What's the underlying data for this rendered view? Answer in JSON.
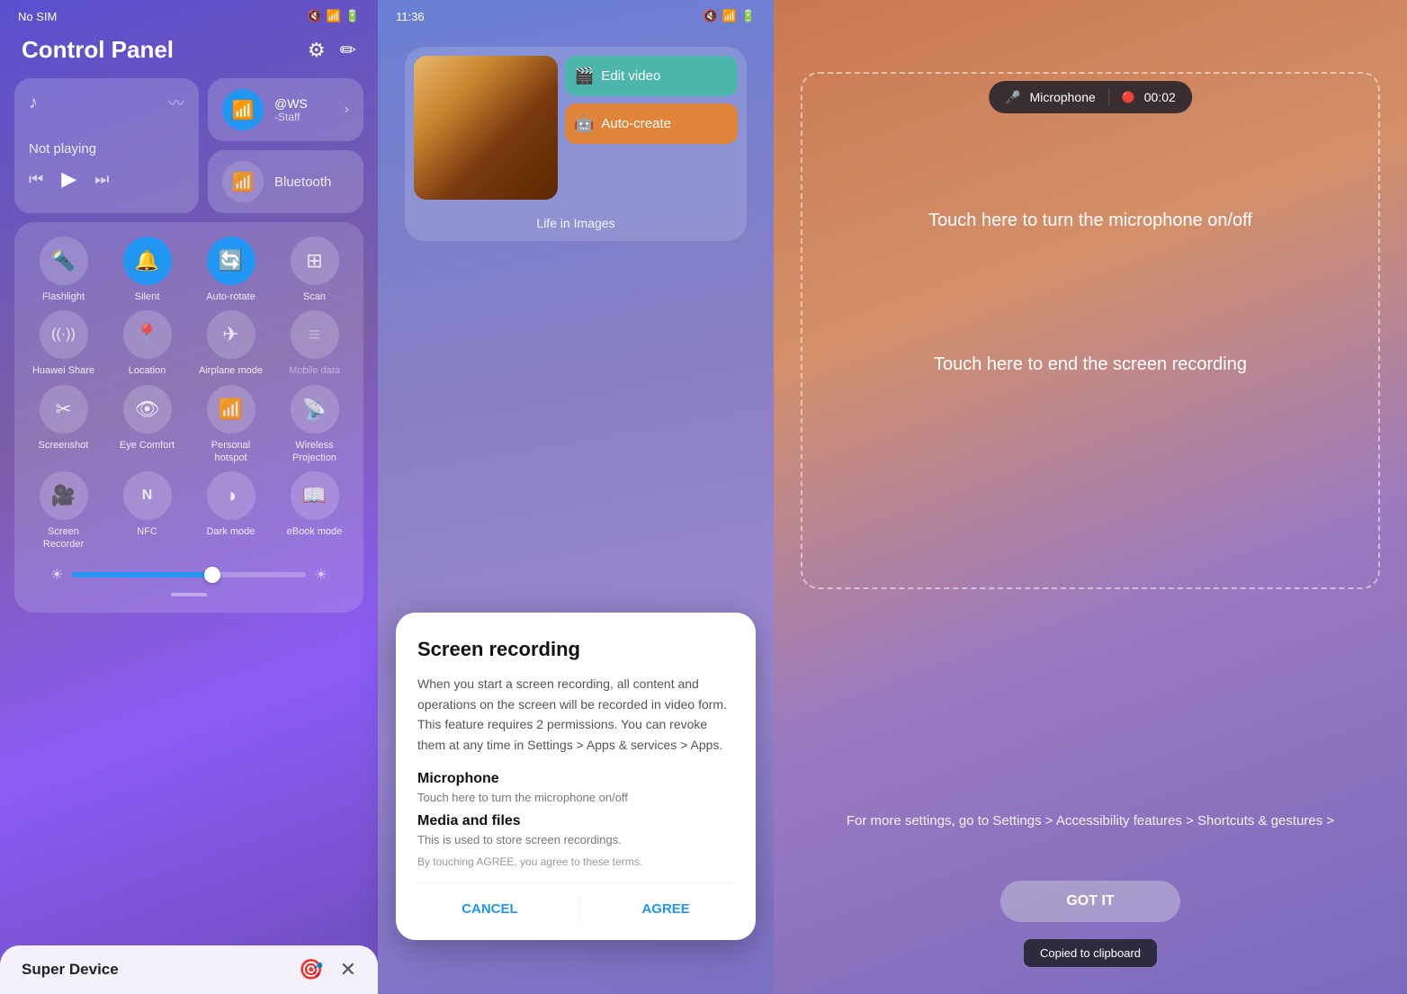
{
  "panel1": {
    "status_bar": {
      "carrier": "No SIM",
      "time": "",
      "icons": [
        "mute",
        "wifi",
        "battery"
      ]
    },
    "title": "Control Panel",
    "media": {
      "not_playing": "Not playing"
    },
    "wifi": {
      "name": "@WS",
      "sub": "-Staff"
    },
    "bluetooth": {
      "label": "Bluetooth"
    },
    "toggles": [
      {
        "id": "flashlight",
        "label": "Flashlight",
        "icon": "🔦",
        "active": false
      },
      {
        "id": "silent",
        "label": "Silent",
        "icon": "🔔",
        "active": true
      },
      {
        "id": "auto-rotate",
        "label": "Auto-rotate",
        "icon": "🔄",
        "active": true
      },
      {
        "id": "scan",
        "label": "Scan",
        "icon": "⊞",
        "active": false
      },
      {
        "id": "huawei-share",
        "label": "Huawei Share",
        "icon": "((·))",
        "active": false
      },
      {
        "id": "location",
        "label": "Location",
        "icon": "📍",
        "active": false
      },
      {
        "id": "airplane-mode",
        "label": "Airplane mode",
        "icon": "✈️",
        "active": false
      },
      {
        "id": "mobile-data",
        "label": "Mobile data",
        "icon": "≡",
        "active": false,
        "dim": true
      },
      {
        "id": "screenshot",
        "label": "Screenshot",
        "icon": "✂",
        "active": false
      },
      {
        "id": "eye-comfort",
        "label": "Eye Comfort",
        "icon": "👁",
        "active": false
      },
      {
        "id": "personal-hotspot",
        "label": "Personal hotspot",
        "icon": "📶",
        "active": false
      },
      {
        "id": "wireless-projection",
        "label": "Wireless Projection",
        "icon": "📡",
        "active": false
      },
      {
        "id": "screen-recorder",
        "label": "Screen Recorder",
        "icon": "🎥",
        "active": false
      },
      {
        "id": "nfc",
        "label": "NFC",
        "icon": "N",
        "active": false
      },
      {
        "id": "dark-mode",
        "label": "Dark mode",
        "icon": "◑",
        "active": false
      },
      {
        "id": "ebook-mode",
        "label": "eBook mode",
        "icon": "📖",
        "active": false
      }
    ],
    "super_device": "Super Device"
  },
  "panel2": {
    "time": "11:36",
    "album": {
      "title": "Life in Images",
      "edit_video": "Edit video",
      "auto_create": "Auto-create"
    },
    "dialog": {
      "title": "Screen recording",
      "body": "When you start a screen recording, all content and operations on the screen will be recorded in video form. This feature requires 2 permissions. You can revoke them at any time in Settings > Apps & services > Apps.",
      "mic_title": "Microphone",
      "mic_desc": "Touch here to turn the microphone on/off",
      "media_title": "Media and files",
      "media_desc": "This is used to store screen recordings.",
      "terms": "By touching AGREE, you agree to these terms.",
      "cancel": "CANCEL",
      "agree": "AGREE"
    }
  },
  "panel3": {
    "mic_label": "Microphone",
    "recording_time": "00:02",
    "touch_mic": "Touch here to turn the\nmicrophone on/off",
    "touch_end": "Touch here to end the screen\nrecording",
    "settings_hint": "For more settings, go to Settings > Accessibility features > Shortcuts & gestures >",
    "got_it": "GOT IT",
    "clipboard": "Copied to clipboard"
  }
}
